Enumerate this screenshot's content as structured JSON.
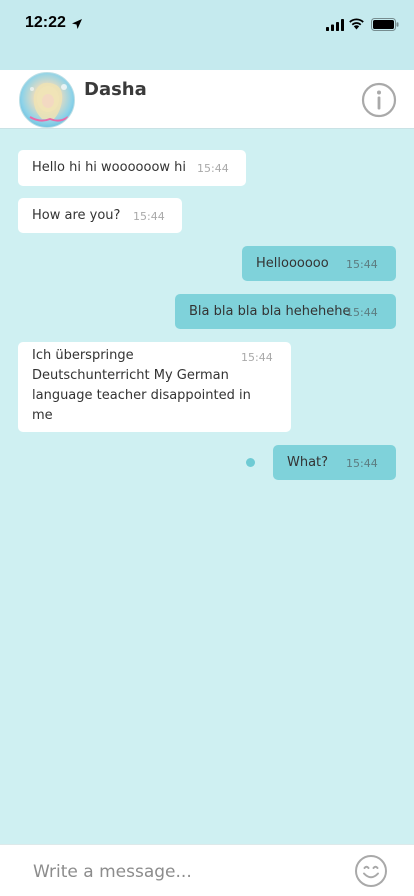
{
  "status_bar": {
    "time": "12:22"
  },
  "header": {
    "contact_name": "Dasha"
  },
  "messages": [
    {
      "direction": "in",
      "text": "Hello hi hi woooooow hi",
      "time": "15:44"
    },
    {
      "direction": "in",
      "text": "How are you?",
      "time": "15:44"
    },
    {
      "direction": "out",
      "text": "Helloooooo",
      "time": "15:44"
    },
    {
      "direction": "out",
      "text": "Bla bla bla bla hehehehe",
      "time": "15:44"
    },
    {
      "direction": "in",
      "text": "Ich überspringe Deutschunterricht My German language teacher disappointed in me",
      "time": "15:44"
    },
    {
      "direction": "out",
      "text": "What?",
      "time": "15:44",
      "status": "pending"
    }
  ],
  "composer": {
    "placeholder": "Write a message..."
  },
  "colors": {
    "background": "#cff0f2",
    "outgoing_bubble": "#7fd2da",
    "incoming_bubble": "#ffffff",
    "accent_dot": "#6fcbd4"
  }
}
